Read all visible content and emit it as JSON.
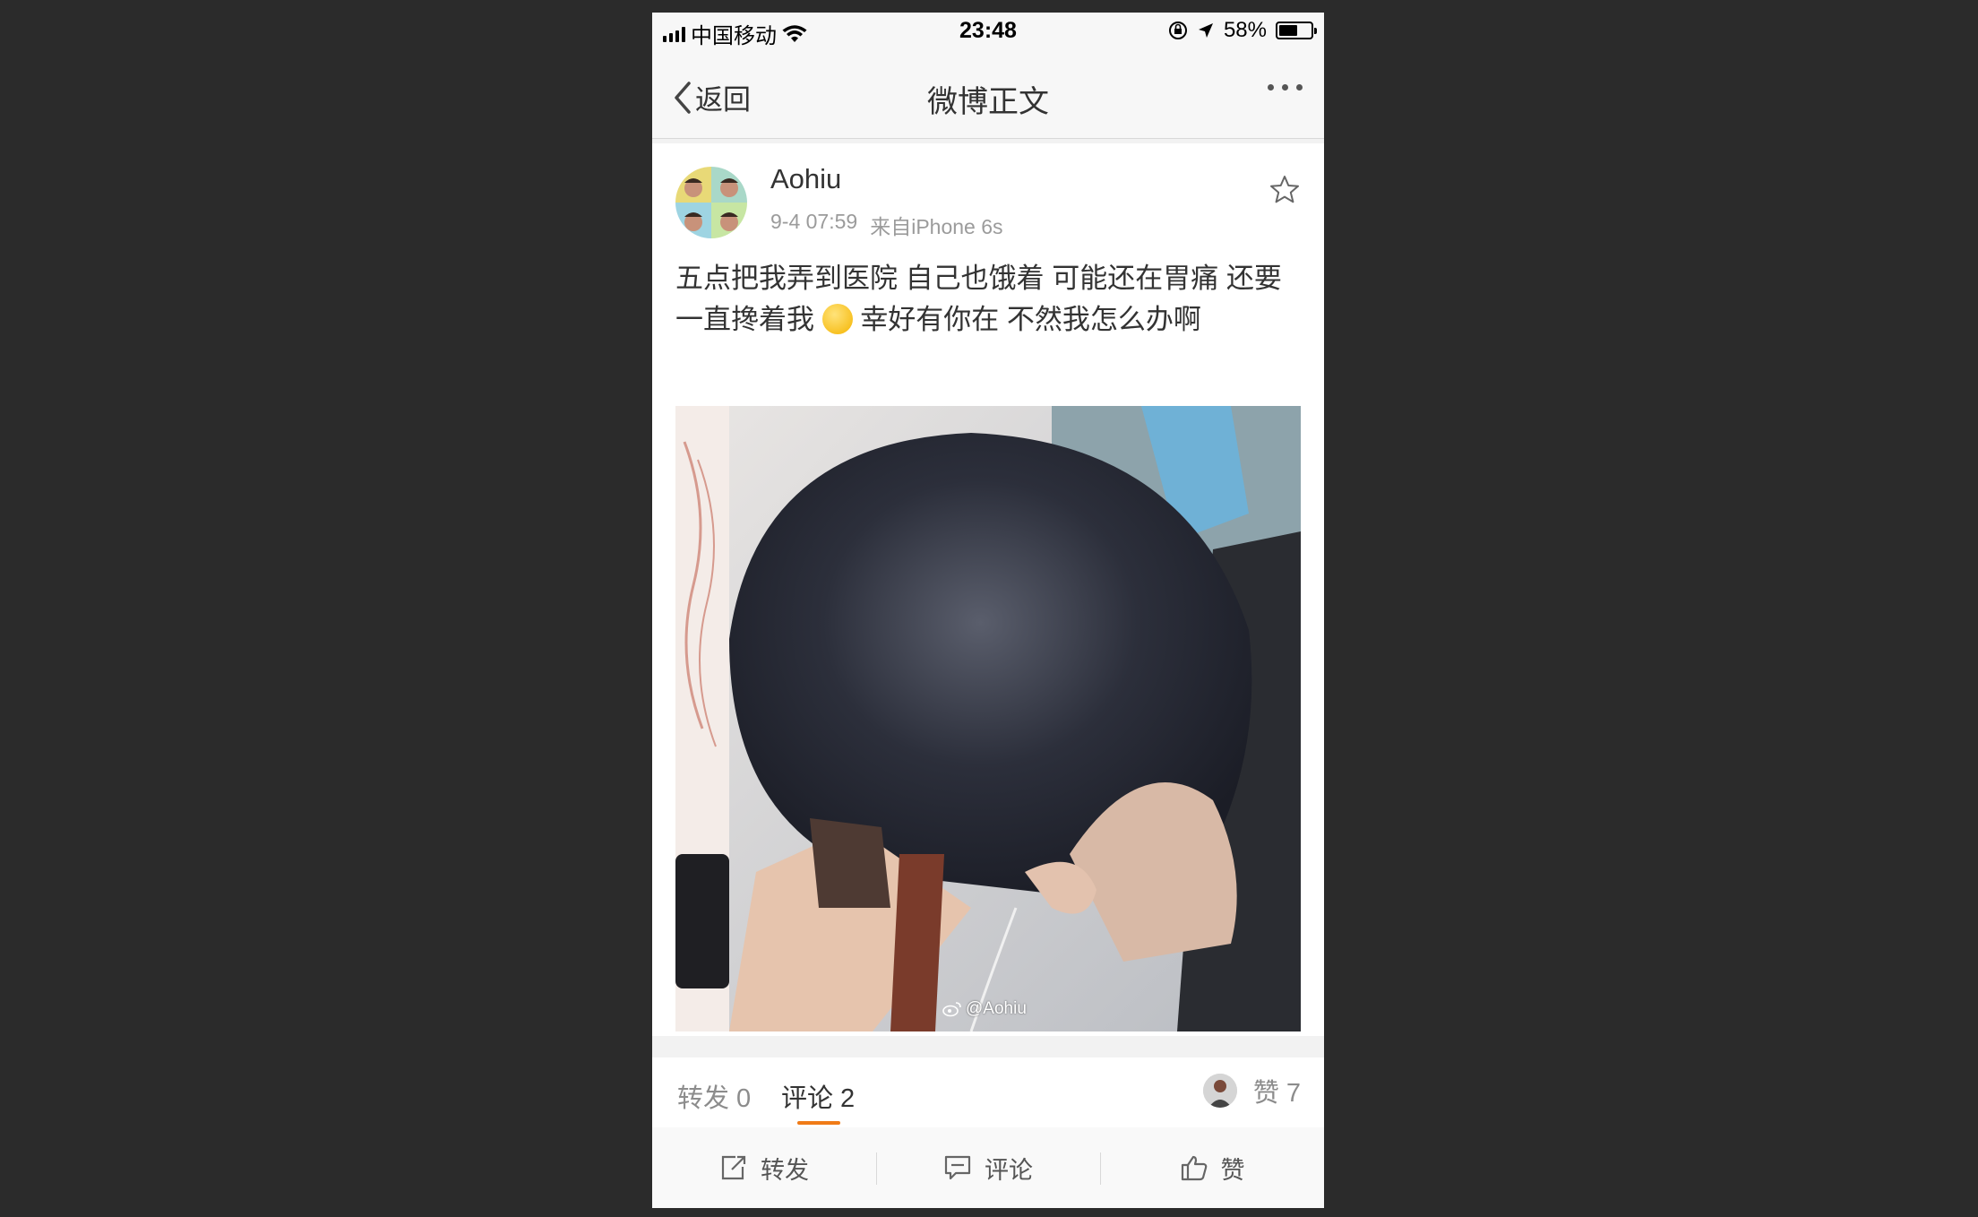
{
  "status_bar": {
    "carrier": "中国移动",
    "time": "23:48",
    "battery": "58%",
    "battery_level": 0.58
  },
  "nav": {
    "back_label": "返回",
    "title": "微博正文"
  },
  "post": {
    "username": "Aohiu",
    "timestamp": "9-4 07:59",
    "source": "来自iPhone 6s",
    "text_part1": "五点把我弄到医院 自己也饿着 可能还在胃痛 还要一直搀着我 ",
    "text_part2": " 幸好有你在 不然我怎么办啊",
    "image_watermark": "@Aohiu"
  },
  "tabs": {
    "repost": "转发 0",
    "comments": "评论 2",
    "likes": "赞 7"
  },
  "toolbar": {
    "repost": "转发",
    "comment": "评论",
    "like": "赞"
  },
  "colors": {
    "accent": "#f07b17",
    "background": "#2b2b2b",
    "text": "#333333",
    "muted": "#9b9b9b"
  }
}
